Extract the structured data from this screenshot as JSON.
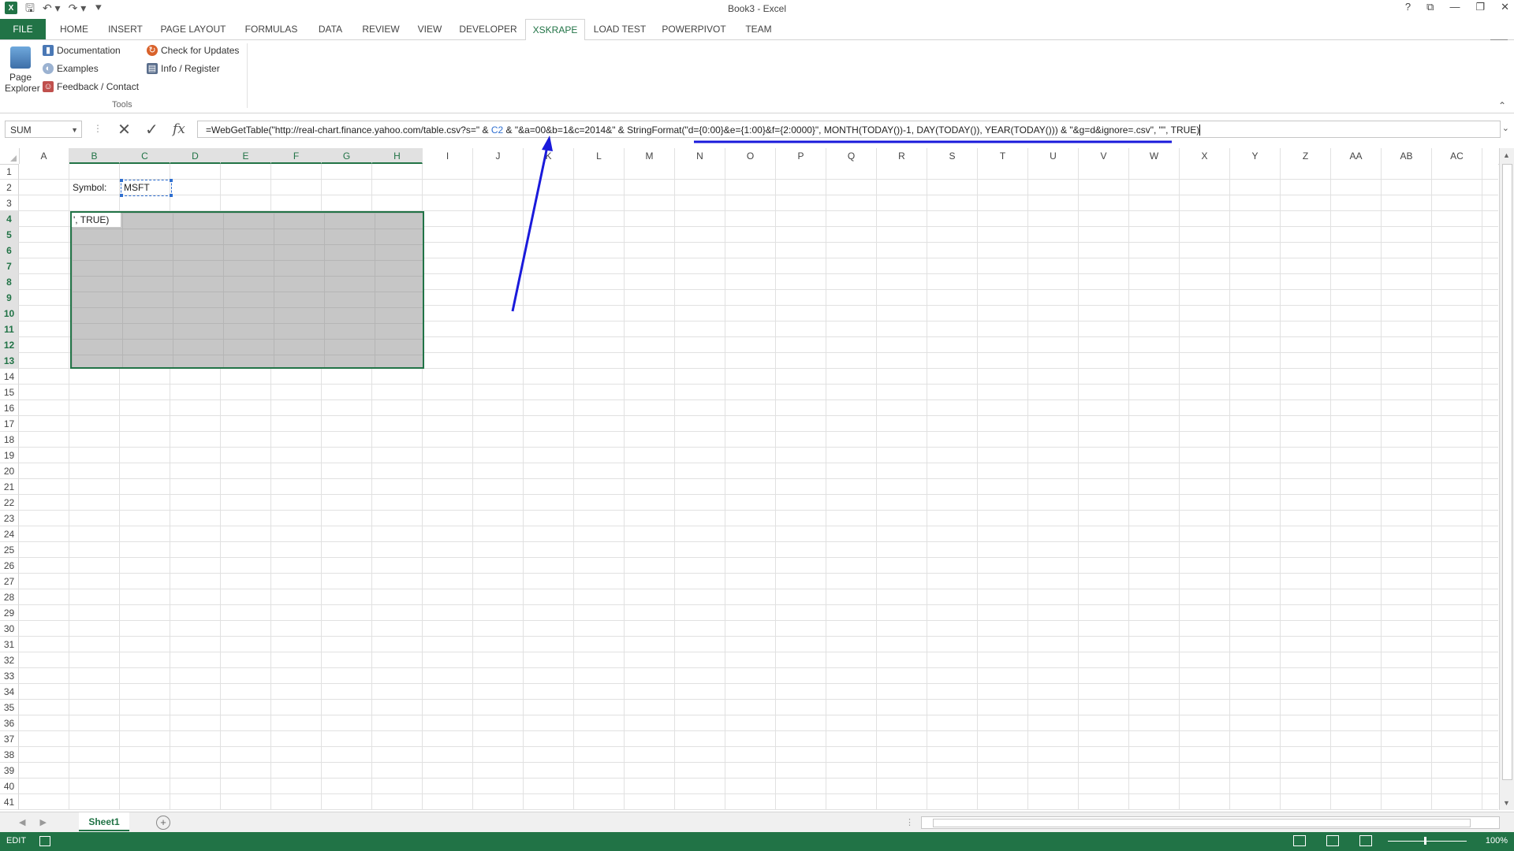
{
  "window": {
    "title": "Book3 - Excel",
    "app_icon": "excel-icon",
    "controls": [
      "?",
      "⧉",
      "—",
      "❐",
      "✕"
    ]
  },
  "ribbon": {
    "tabs": [
      "FILE",
      "HOME",
      "INSERT",
      "PAGE LAYOUT",
      "FORMULAS",
      "DATA",
      "REVIEW",
      "VIEW",
      "DEVELOPER",
      "XSKRAPE",
      "LOAD TEST",
      "POWERPIVOT",
      "TEAM"
    ],
    "active_tab": "XSKRAPE",
    "page_explorer_label": "Page Explorer",
    "documentation": "Documentation",
    "examples": "Examples",
    "feedback": "Feedback / Contact",
    "check_updates": "Check for Updates",
    "info_register": "Info / Register",
    "group_label": "Tools"
  },
  "formula_bar": {
    "name_box": "SUM",
    "fx": "fx",
    "formula_before": "=WebGetTable(\"http://real-chart.finance.yahoo.com/table.csv?s=\" & ",
    "formula_ref": "C2",
    "formula_after": " & \"&a=00&b=1&c=2014&\" & StringFormat(\"d={0:00}&e={1:00}&f={2:0000}\", MONTH(TODAY())-1, DAY(TODAY()), YEAR(TODAY())) & \"&g=d&ignore=.csv\", \"\", TRUE)"
  },
  "grid": {
    "columns": [
      "A",
      "B",
      "C",
      "D",
      "E",
      "F",
      "G",
      "H",
      "I",
      "J",
      "K",
      "L",
      "M",
      "N",
      "O",
      "P",
      "Q",
      "R",
      "S",
      "T",
      "U",
      "V",
      "W",
      "X",
      "Y",
      "Z",
      "AA",
      "AB",
      "AC"
    ],
    "selected_columns": [
      "B",
      "C",
      "D",
      "E",
      "F",
      "G",
      "H"
    ],
    "row_count": 41,
    "selected_rows": [
      4,
      5,
      6,
      7,
      8,
      9,
      10,
      11,
      12,
      13
    ],
    "symbol_label": "Symbol:",
    "symbol_value": "MSFT",
    "active_cell_text": "', TRUE)"
  },
  "sheets": {
    "tabs": [
      "Sheet1"
    ],
    "active": "Sheet1"
  },
  "status": {
    "mode": "EDIT",
    "zoom": "100%"
  },
  "colors": {
    "excel_green": "#217346",
    "annotation_blue": "#1a1adb",
    "reference_blue": "#2f6fd0"
  }
}
